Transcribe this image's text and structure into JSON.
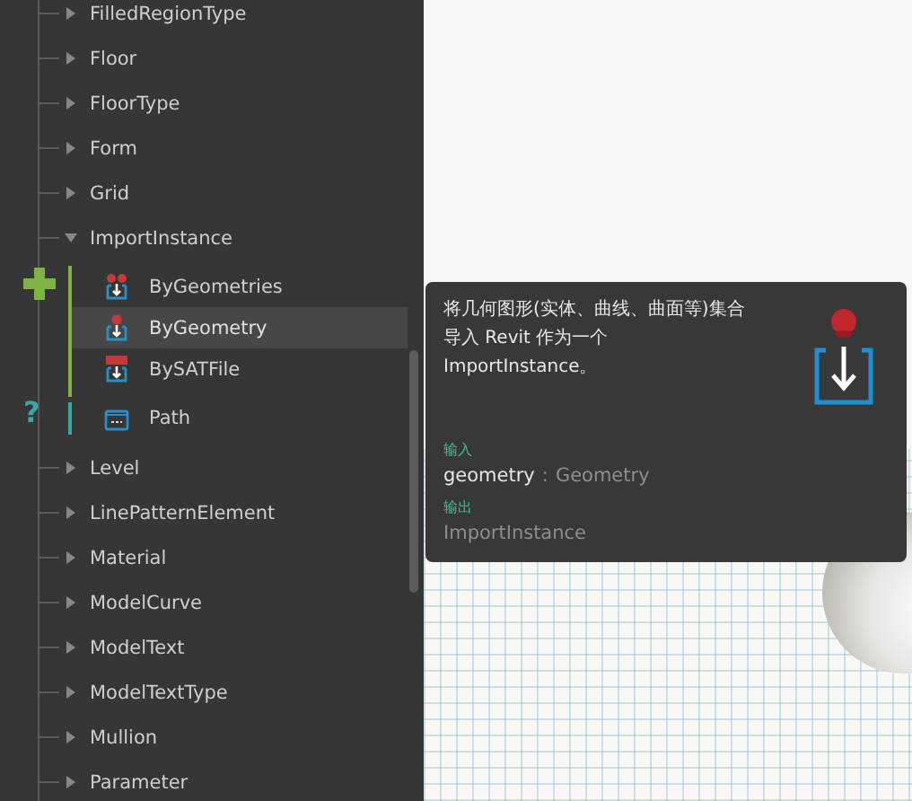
{
  "library": {
    "items": [
      {
        "label": "FilledRegionType",
        "expanded": false
      },
      {
        "label": "Floor",
        "expanded": false
      },
      {
        "label": "FloorType",
        "expanded": false
      },
      {
        "label": "Form",
        "expanded": false
      },
      {
        "label": "Grid",
        "expanded": false
      },
      {
        "label": "ImportInstance",
        "expanded": true,
        "groups": [
          {
            "kind": "create",
            "items": [
              {
                "label": "ByGeometries",
                "selected": false
              },
              {
                "label": "ByGeometry",
                "selected": true
              },
              {
                "label": "BySATFile",
                "selected": false
              }
            ]
          },
          {
            "kind": "query",
            "symbol": "?",
            "items": [
              {
                "label": "Path",
                "selected": false
              }
            ]
          }
        ]
      },
      {
        "label": "Level",
        "expanded": false
      },
      {
        "label": "LinePatternElement",
        "expanded": false
      },
      {
        "label": "Material",
        "expanded": false
      },
      {
        "label": "ModelCurve",
        "expanded": false
      },
      {
        "label": "ModelText",
        "expanded": false
      },
      {
        "label": "ModelTextType",
        "expanded": false
      },
      {
        "label": "Mullion",
        "expanded": false
      },
      {
        "label": "Parameter",
        "expanded": false
      }
    ]
  },
  "tooltip": {
    "description": "将几何图形(实体、曲线、曲面等)集合导入 Revit 作为一个 ImportInstance。",
    "inputs_label": "输入",
    "inputs": [
      {
        "name": "geometry",
        "separator": ":",
        "type": "Geometry"
      }
    ],
    "outputs_label": "输出",
    "outputs": [
      "ImportInstance"
    ]
  }
}
